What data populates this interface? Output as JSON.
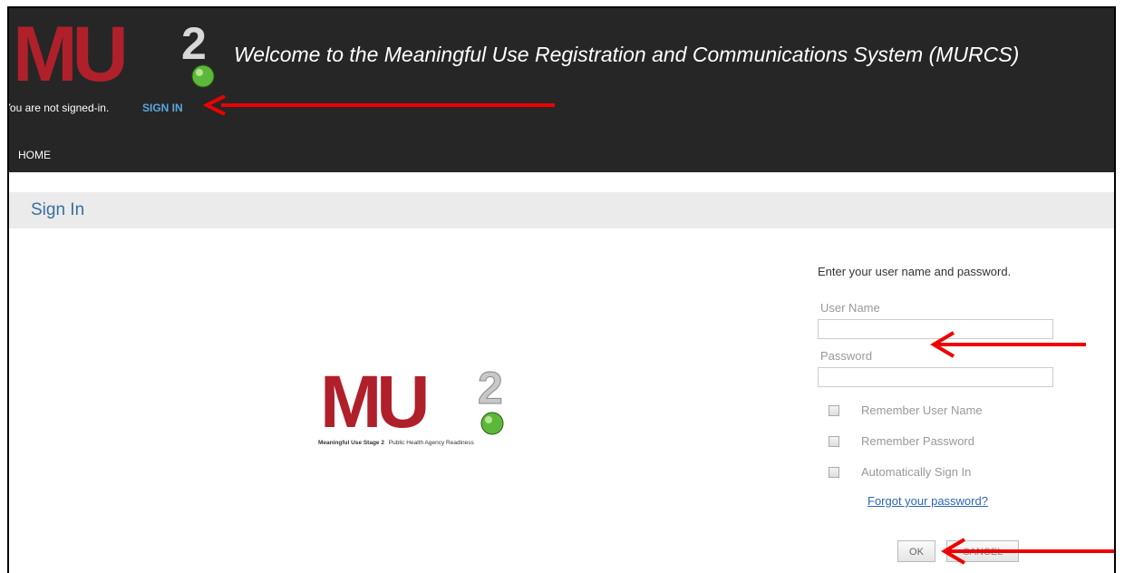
{
  "header": {
    "welcome": "Welcome to the Meaningful Use Registration and Communications System (MURCS)",
    "status_text": "You are not signed-in.",
    "signin_link": "SIGN IN",
    "nav_home": "HOME"
  },
  "logo": {
    "text": "MU",
    "superscript": "2",
    "tagline_bold": "Meaningful Use Stage 2",
    "tagline_rest": "Public Health Agency Readiness"
  },
  "page": {
    "title": "Sign In"
  },
  "form": {
    "instructions": "Enter your user name and password.",
    "username_label": "User Name",
    "username_value": "",
    "password_label": "Password",
    "password_value": "",
    "remember_username": "Remember User Name",
    "remember_password": "Remember Password",
    "auto_signin": "Automatically Sign In",
    "forgot_link": "Forgot your password?",
    "ok_label": "OK",
    "cancel_label": "CANCEL"
  },
  "colors": {
    "header_bg": "#262626",
    "link_blue": "#5aa6de",
    "title_blue": "#3a6ea0",
    "annotation_arrow": "#ee0000",
    "logo_red": "#b0202a"
  }
}
